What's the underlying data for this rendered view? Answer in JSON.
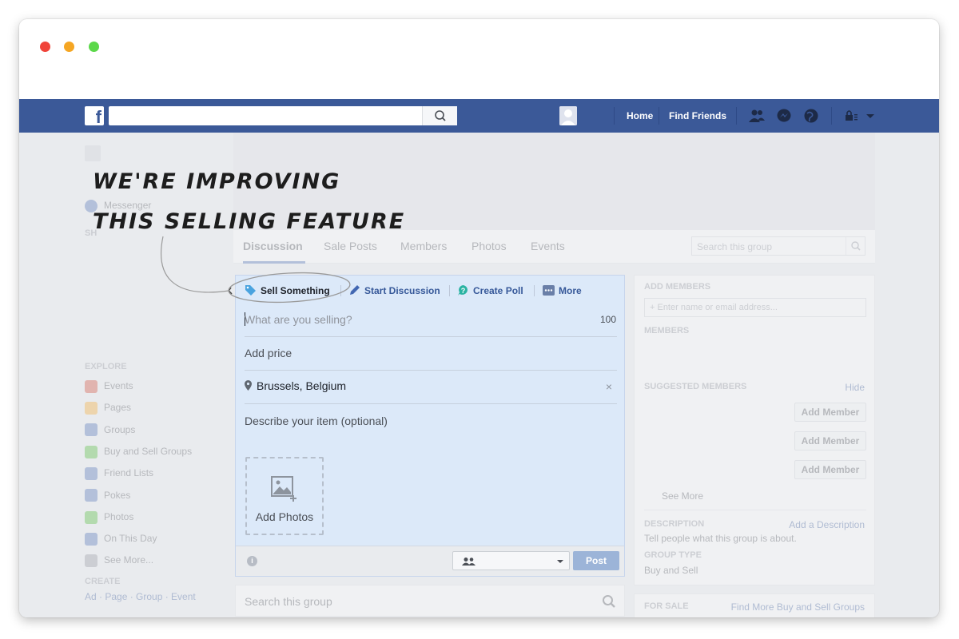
{
  "fb": {
    "logo": "f",
    "nav": {
      "home": "Home",
      "find_friends": "Find Friends"
    }
  },
  "sidebar": {
    "messenger": "Messenger",
    "shortcuts_head": "SH",
    "explore_head": "EXPLORE",
    "explore": [
      {
        "label": "Events",
        "color": "#d1412c"
      },
      {
        "label": "Pages",
        "color": "#f5a623"
      },
      {
        "label": "Groups",
        "color": "#4267b2"
      },
      {
        "label": "Buy and Sell Groups",
        "color": "#42b72a"
      },
      {
        "label": "Friend Lists",
        "color": "#4267b2"
      },
      {
        "label": "Pokes",
        "color": "#4267b2"
      },
      {
        "label": "Photos",
        "color": "#42b72a"
      },
      {
        "label": "On This Day",
        "color": "#4267b2"
      },
      {
        "label": "See More...",
        "color": "#90949c"
      }
    ],
    "create_head": "CREATE",
    "create_links": "Ad · Page · Group · Event"
  },
  "group": {
    "tabs": [
      "Discussion",
      "Sale Posts",
      "Members",
      "Photos",
      "Events"
    ],
    "search_placeholder": "Search this group"
  },
  "composer": {
    "tabs": {
      "sell": "Sell Something",
      "discussion": "Start Discussion",
      "poll": "Create Poll",
      "more": "More"
    },
    "title_placeholder": "What are you selling?",
    "char_count": "100",
    "price_placeholder": "Add price",
    "location": "Brussels, Belgium",
    "description_placeholder": "Describe your item (optional)",
    "add_photos": "Add Photos",
    "post": "Post",
    "info": "i"
  },
  "bottom_search": "Search this group",
  "right": {
    "add_members_head": "ADD MEMBERS",
    "add_members_placeholder": "+ Enter name or email address...",
    "members_head": "MEMBERS",
    "suggested_head": "SUGGESTED MEMBERS",
    "hide": "Hide",
    "add_member": "Add Member",
    "see_more": "See More",
    "description_head": "DESCRIPTION",
    "add_description": "Add a Description",
    "description_text": "Tell people what this group is about.",
    "group_type_head": "GROUP TYPE",
    "group_type": "Buy and Sell",
    "for_sale_head": "FOR SALE",
    "find_more": "Find More Buy and Sell Groups"
  },
  "annotation": {
    "line1": "WE'RE IMPROVING",
    "line2": "THIS SELLING FEATURE"
  },
  "colors": {
    "fb_blue": "#3b5998",
    "link_blue": "#365899",
    "composer_bg": "#dce9f9"
  }
}
